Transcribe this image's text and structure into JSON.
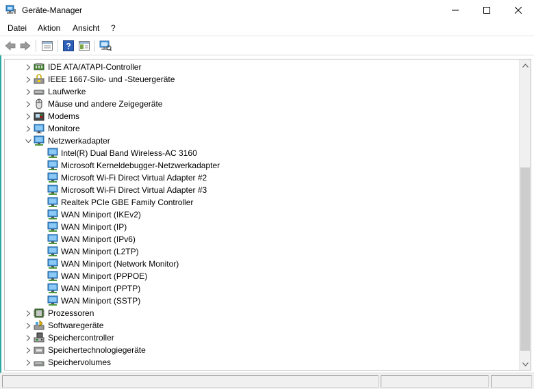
{
  "window": {
    "title": "Geräte-Manager",
    "accent_color": "#2ba8a0"
  },
  "menu": {
    "items": [
      "Datei",
      "Aktion",
      "Ansicht",
      "?"
    ]
  },
  "toolbar": {
    "buttons": [
      "back-arrow-icon",
      "forward-arrow-icon",
      "properties-icon",
      "help-icon",
      "console-view-icon",
      "scan-hardware-icon"
    ]
  },
  "tree": {
    "categories_before": [
      {
        "label": "IDE ATA/ATAPI-Controller",
        "icon": "ide-controller-icon",
        "expanded": false
      },
      {
        "label": "IEEE 1667-Silo- und -Steuergeräte",
        "icon": "ieee1667-icon",
        "expanded": false
      },
      {
        "label": "Laufwerke",
        "icon": "disk-drive-icon",
        "expanded": false
      },
      {
        "label": "Mäuse und andere Zeigegeräte",
        "icon": "mouse-icon",
        "expanded": false
      },
      {
        "label": "Modems",
        "icon": "modem-icon",
        "expanded": false
      },
      {
        "label": "Monitore",
        "icon": "monitor-icon",
        "expanded": false
      }
    ],
    "expanded_category": {
      "label": "Netzwerkadapter",
      "icon": "network-adapter-icon",
      "expanded": true,
      "children": [
        "Intel(R) Dual Band Wireless-AC 3160",
        "Microsoft Kerneldebugger-Netzwerkadapter",
        "Microsoft Wi-Fi Direct Virtual Adapter #2",
        "Microsoft Wi-Fi Direct Virtual Adapter #3",
        "Realtek PCIe GBE Family Controller",
        "WAN Miniport (IKEv2)",
        "WAN Miniport (IP)",
        "WAN Miniport (IPv6)",
        "WAN Miniport (L2TP)",
        "WAN Miniport (Network Monitor)",
        "WAN Miniport (PPPOE)",
        "WAN Miniport (PPTP)",
        "WAN Miniport (SSTP)"
      ]
    },
    "categories_after": [
      {
        "label": "Prozessoren",
        "icon": "processor-icon",
        "expanded": false
      },
      {
        "label": "Softwaregeräte",
        "icon": "software-device-icon",
        "expanded": false
      },
      {
        "label": "Speichercontroller",
        "icon": "storage-controller-icon",
        "expanded": false
      },
      {
        "label": "Speichertechnologiegeräte",
        "icon": "memory-technology-icon",
        "expanded": false
      },
      {
        "label": "Speichervolumes",
        "icon": "storage-volume-icon",
        "expanded": false
      }
    ]
  }
}
